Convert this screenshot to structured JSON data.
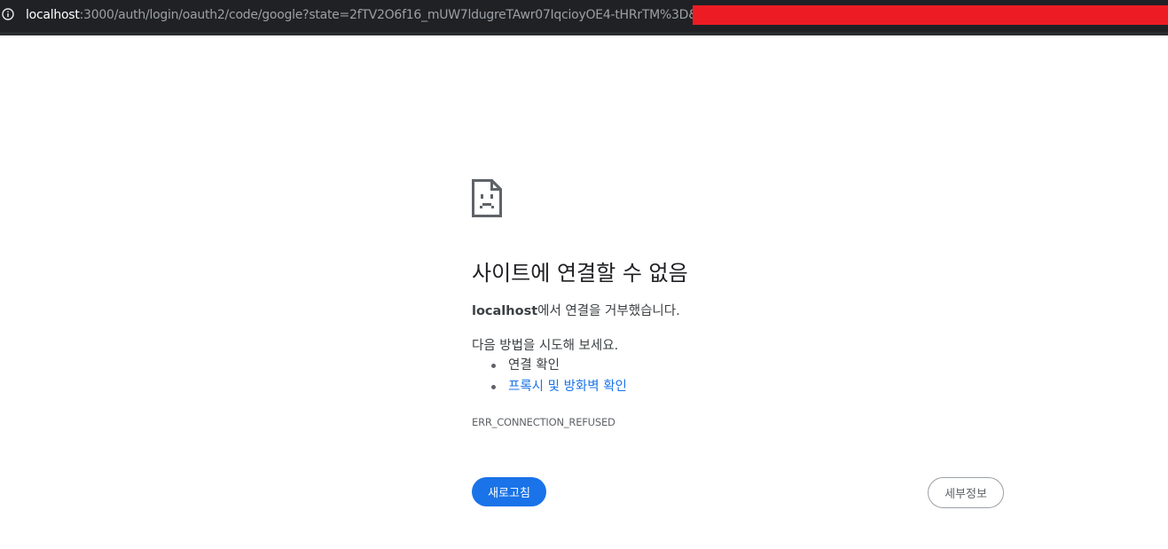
{
  "address_bar": {
    "host": "localhost",
    "rest": ":3000/auth/login/oauth2/code/google?state=2fTV2O6f16_mUW7ldugreTAwr07IqcioyOE4-tHRrTM%3D&code=",
    "info_icon": "info-icon",
    "redaction_color": "#ed1c24"
  },
  "error_page": {
    "icon": "sad-page-icon",
    "title": "사이트에 연결할 수 없음",
    "desc_host": "localhost",
    "desc_rest": "에서 연결을 거부했습니다.",
    "try_label": "다음 방법을 시도해 보세요.",
    "suggestions": [
      {
        "label": "연결 확인",
        "is_link": false
      },
      {
        "label": "프록시 및 방화벽 확인",
        "is_link": true
      }
    ],
    "error_code": "ERR_CONNECTION_REFUSED",
    "reload_label": "새로고침",
    "details_label": "세부정보",
    "colors": {
      "accent": "#1a73e8",
      "text": "#3c4043",
      "address_bar_bg": "#202124"
    }
  }
}
